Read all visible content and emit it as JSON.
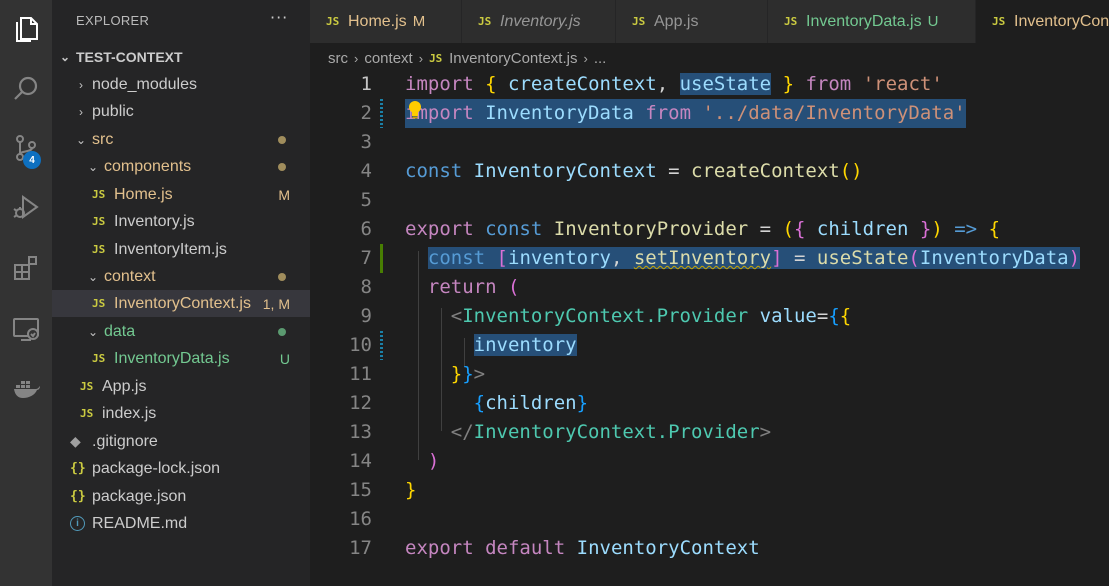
{
  "activity_bar": {
    "items": [
      "explorer-icon",
      "search-icon",
      "source-control-icon",
      "run-debug-icon",
      "extensions-icon",
      "remote-explorer-icon",
      "docker-icon"
    ],
    "source_control_badge": "4"
  },
  "sidebar": {
    "title": "EXPLORER",
    "more": "···",
    "root": "TEST-CONTEXT",
    "items": [
      {
        "label": "node_modules",
        "kind": "folder",
        "collapsed": true
      },
      {
        "label": "public",
        "kind": "folder",
        "collapsed": true
      },
      {
        "label": "src",
        "kind": "folder",
        "collapsed": false
      },
      {
        "label": "components",
        "kind": "folder",
        "collapsed": false
      },
      {
        "label": "Home.js",
        "kind": "js",
        "status": "M"
      },
      {
        "label": "Inventory.js",
        "kind": "js"
      },
      {
        "label": "InventoryItem.js",
        "kind": "js"
      },
      {
        "label": "context",
        "kind": "folder",
        "collapsed": false
      },
      {
        "label": "InventoryContext.js",
        "kind": "js",
        "status": "1, M"
      },
      {
        "label": "data",
        "kind": "folder",
        "collapsed": false
      },
      {
        "label": "InventoryData.js",
        "kind": "js",
        "status": "U"
      },
      {
        "label": "App.js",
        "kind": "js"
      },
      {
        "label": "index.js",
        "kind": "js"
      },
      {
        "label": ".gitignore",
        "kind": "git"
      },
      {
        "label": "package-lock.json",
        "kind": "json"
      },
      {
        "label": "package.json",
        "kind": "json"
      },
      {
        "label": "README.md",
        "kind": "info"
      }
    ]
  },
  "tabs": [
    {
      "label": "Home.js",
      "status": "M",
      "icon": "JS"
    },
    {
      "label": "Inventory.js",
      "icon": "JS"
    },
    {
      "label": "App.js",
      "icon": "JS"
    },
    {
      "label": "InventoryData.js",
      "status": "U",
      "icon": "JS"
    },
    {
      "label": "InventoryCon",
      "icon": "JS"
    }
  ],
  "breadcrumb": {
    "parts": [
      "src",
      "context"
    ],
    "file": "InventoryContext.js",
    "trail": "..."
  },
  "editor": {
    "line_numbers": [
      "1",
      "2",
      "3",
      "4",
      "5",
      "6",
      "7",
      "8",
      "9",
      "10",
      "11",
      "12",
      "13",
      "14",
      "15",
      "16",
      "17"
    ],
    "lines": [
      "import { createContext, useState } from 'react'",
      "import InventoryData from '../data/InventoryData'",
      "",
      "const InventoryContext = createContext()",
      "",
      "export const InventoryProvider = ({ children }) => {",
      "  const [inventory, setInventory] = useState(InventoryData)",
      "  return (",
      "    <InventoryContext.Provider value={{",
      "      inventory",
      "    }}>",
      "      {children}",
      "    </InventoryContext.Provider>",
      "  )",
      "}",
      "",
      "export default InventoryContext"
    ]
  },
  "colors": {
    "activity_bar": "#333333",
    "sidebar": "#252526",
    "editor": "#1e1e1e",
    "modified": "#e2c08d",
    "untracked": "#73c991",
    "badge": "#0e70c0"
  }
}
